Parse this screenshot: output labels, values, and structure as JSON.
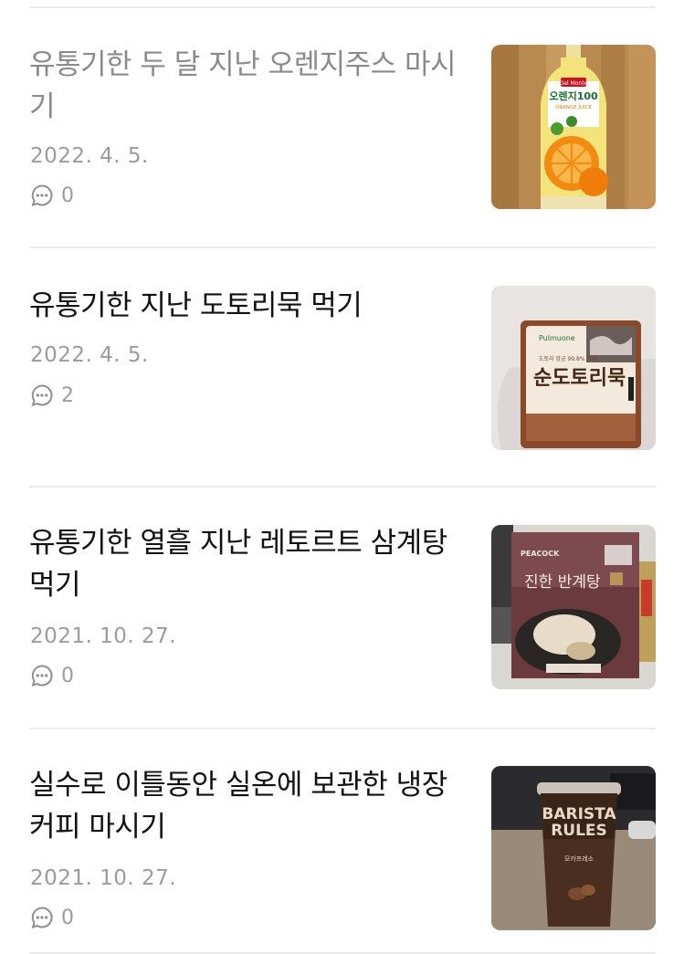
{
  "posts": [
    {
      "title": "유통기한 두 달 지난 오렌지주스 마시기",
      "date": "2022. 4. 5.",
      "comments": "0",
      "thumbnail": {
        "icon": "orange-juice-bottle",
        "brand": "Del Monte",
        "label": "오렌지100",
        "sublabel": "ORANGE JUICE"
      }
    },
    {
      "title": "유통기한 지난 도토리묵 먹기",
      "date": "2022. 4. 5.",
      "comments": "2",
      "thumbnail": {
        "icon": "acorn-jelly-package",
        "brand": "Pulmuone",
        "label": "순도토리묵",
        "sublabel": "도토리 앙금 99.8% 함유"
      }
    },
    {
      "title": "유통기한 열흘 지난 레토르트 삼계탕 먹기",
      "date": "2021. 10. 27.",
      "comments": "0",
      "thumbnail": {
        "icon": "samgyetang-pouch",
        "brand": "PEACOCK",
        "label": "진한 반계탕"
      }
    },
    {
      "title": "실수로 이틀동안 실온에 보관한 냉장커피 마시기",
      "date": "2021. 10. 27.",
      "comments": "0",
      "thumbnail": {
        "icon": "coffee-cup",
        "brand": "BARISTA",
        "label": "RULES",
        "sublabel": "모카프레소"
      }
    }
  ]
}
